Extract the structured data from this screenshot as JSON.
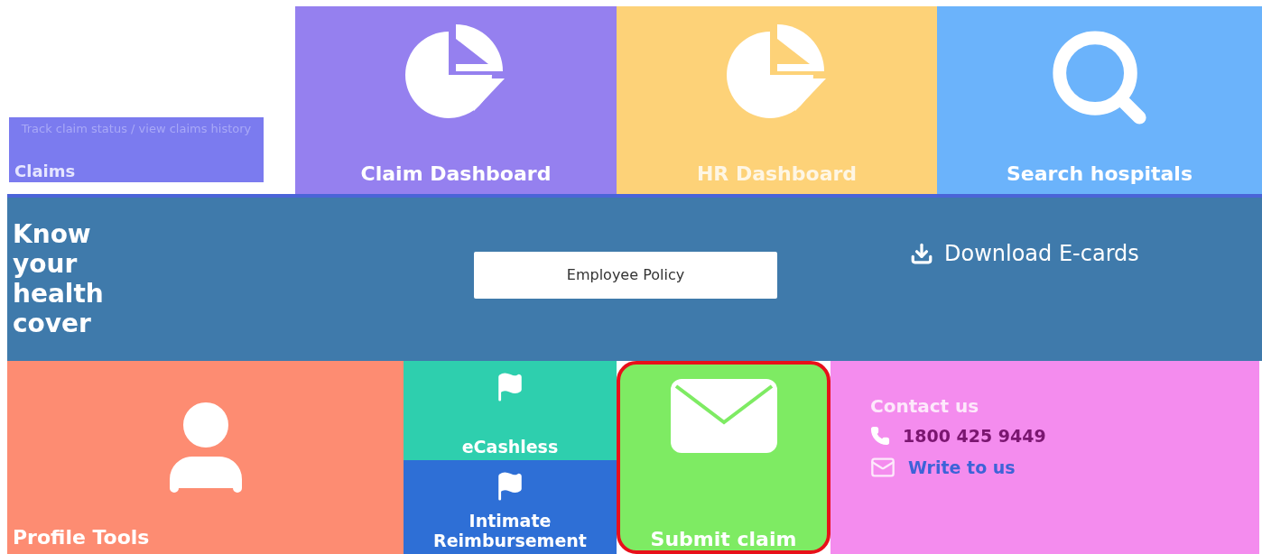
{
  "claims_tile": {
    "label": "Claims",
    "tooltip": "Track claim status / view claims history"
  },
  "top_tiles": [
    {
      "kind": "pie",
      "label": "Claim Dashboard",
      "color": "#9580ef"
    },
    {
      "kind": "pie",
      "label": "HR Dashboard",
      "color": "#fdd278"
    },
    {
      "kind": "search",
      "label": "Search hospitals",
      "color": "#6bb3fb"
    }
  ],
  "cover_band": {
    "title": "Know your health cover",
    "button": "Employee Policy",
    "download": "Download E-cards"
  },
  "profile_tile": {
    "label": "Profile Tools"
  },
  "small_tiles": [
    {
      "label": "eCashless",
      "color": "#2ecfae"
    },
    {
      "label": "Intimate Reimbursement",
      "color": "#2e6fd6"
    }
  ],
  "submit_tile": {
    "label": "Submit claim",
    "highlighted": true
  },
  "contact": {
    "title": "Contact us",
    "phone": "1800 425 9449",
    "link": "Write to us"
  }
}
